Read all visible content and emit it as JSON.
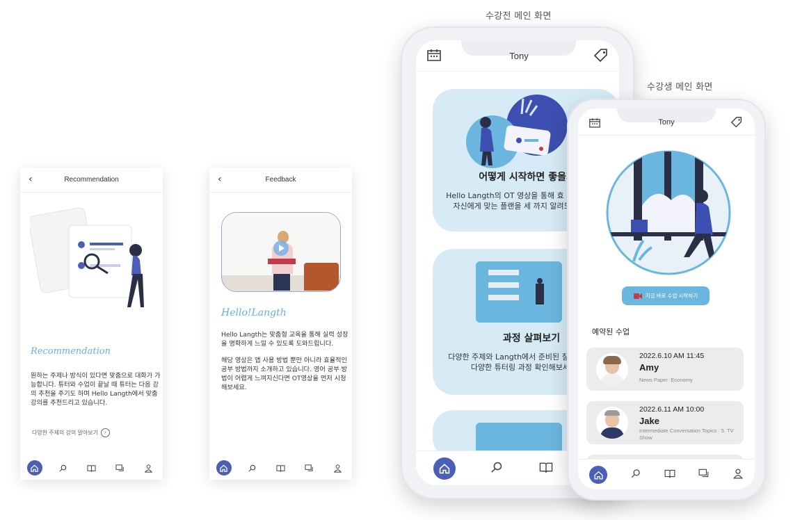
{
  "captions": {
    "pre_student": "수강전 메인 화면",
    "student": "수강생 메인 화면"
  },
  "recommendation_screen": {
    "back_icon": "chevron-left-icon",
    "title": "Recommendation",
    "heading": "Recommendation",
    "body": "원하는 주제나 방식이 있다면 맞춤으로 대화가 가능합니다. 튜터와 수업이 끝날 때 튜터는 다음 강의 추천을 주기도 하며 Hello Langth에서 맞춤 강의를 추천드리고 있습니다.",
    "link": "다양한 주제의 강의 알아보기"
  },
  "feedback_screen": {
    "back_icon": "chevron-left-icon",
    "title": "Feedback",
    "heading": "Hello!Langth",
    "body1": "Hello Langth는 맞춤형 교육을 통해 실력 성장을 명확하게 느낄 수 있도록 도와드립니다.",
    "body2": "해당 영상은 앱 사용 방법 뿐만 아니라 효율적인 공부 방법까지 소개하고 있습니다. 영어 공부 방법이 어렵게 느껴지신다면 OT영상을 먼저 시청해보세요."
  },
  "pre_phone": {
    "header_name": "Tony",
    "card1_title": "어떻게 시작하면 좋을까요",
    "card1_body": "Hello Langth의 OT 영상을 통해 효 사용법부터 자신에게 맞는 플랜을 세 까지 알려드립니다.",
    "card2_title": "과정 살펴보기",
    "card2_body": "다양한 주제와 Langth에서 준비된 질문을 통해 다양한 튜터링 과정 확인해보세요"
  },
  "student_phone": {
    "header_name": "Tony",
    "start_button": "지금 바로 수업 시작하기",
    "section_title": "예약된 수업",
    "lessons": [
      {
        "datetime": "2022.6.10 AM 11:45",
        "name": "Amy",
        "topic": "News Paper ·Economy"
      },
      {
        "datetime": "2022.6.11 AM 10:00",
        "name": "Jake",
        "topic": "Intermediate Conversation Topics · 5. TV Show"
      }
    ]
  },
  "nav_items": [
    "home-icon",
    "search-icon",
    "book-icon",
    "chat-icon",
    "user-icon"
  ],
  "colors": {
    "accent": "#4a5fb5",
    "light_blue": "#64b0dc",
    "card_bg": "#d6ebf6"
  }
}
